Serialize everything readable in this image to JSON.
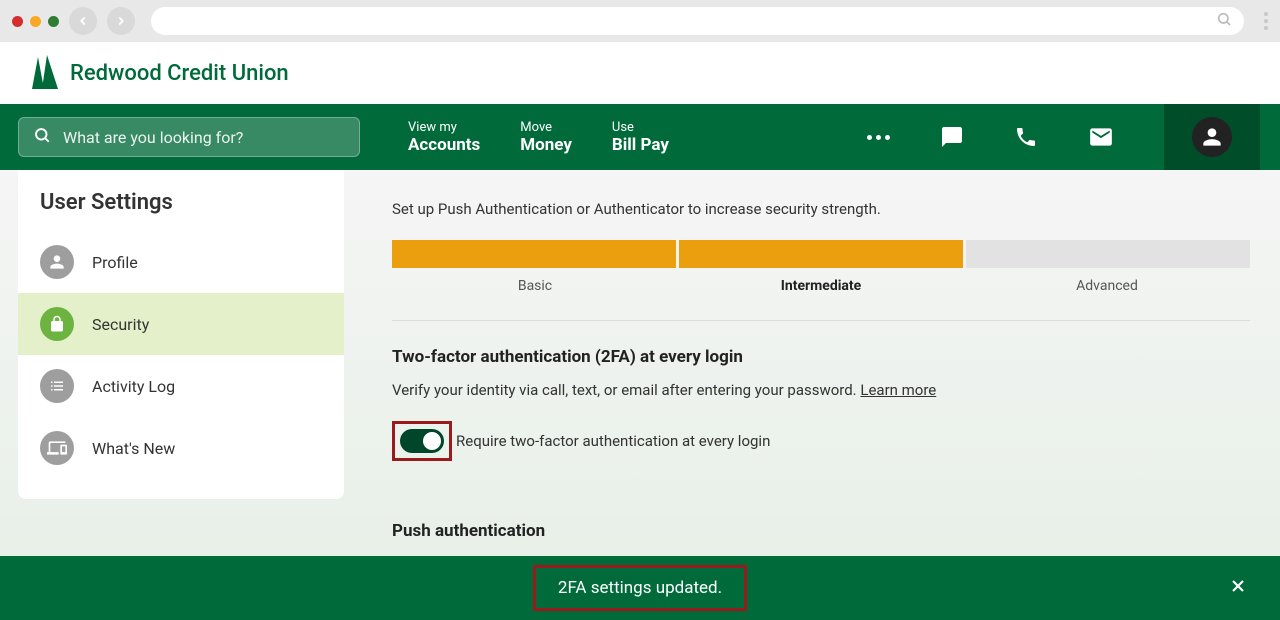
{
  "logo_text": "Redwood Credit Union",
  "search": {
    "placeholder": "What are you looking for?"
  },
  "nav": [
    {
      "top": "View my",
      "bottom": "Accounts"
    },
    {
      "top": "Move",
      "bottom": "Money"
    },
    {
      "top": "Use",
      "bottom": "Bill Pay"
    }
  ],
  "sidebar": {
    "title": "User Settings",
    "items": [
      {
        "label": "Profile"
      },
      {
        "label": "Security"
      },
      {
        "label": "Activity Log"
      },
      {
        "label": "What's New"
      }
    ]
  },
  "main": {
    "desc": "Set up Push Authentication or Authenticator to increase security strength.",
    "strength_labels": {
      "basic": "Basic",
      "intermediate": "Intermediate",
      "advanced": "Advanced"
    },
    "tfa": {
      "title": "Two-factor authentication (2FA) at every login",
      "desc": "Verify your identity via call, text, or email after entering your password. ",
      "learn_more": "Learn more",
      "toggle_label": "Require two-factor authentication at every login"
    },
    "push_title": "Push authentication"
  },
  "toast": {
    "message": "2FA settings updated."
  }
}
